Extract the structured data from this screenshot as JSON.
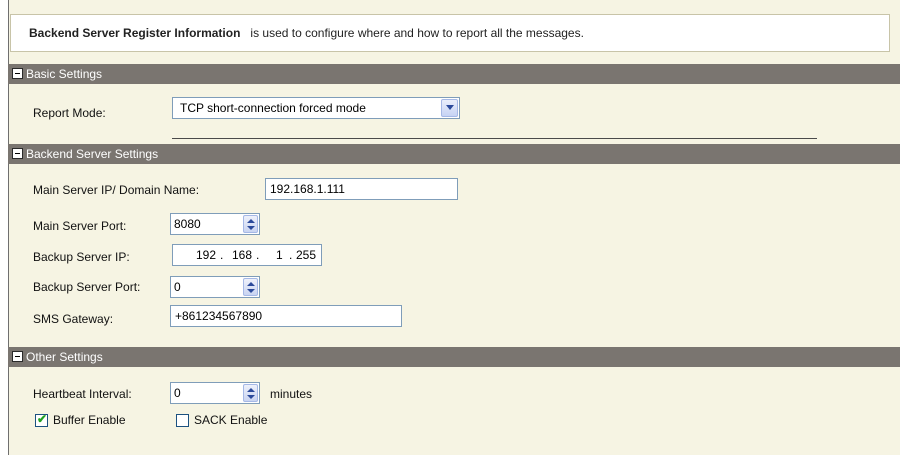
{
  "info": {
    "title_bold": "Backend Server Register Information",
    "description": "is used to configure where and how to report all the messages."
  },
  "basic": {
    "header": "Basic Settings",
    "report_mode_label": "Report Mode:",
    "report_mode_value": "TCP short-connection forced mode"
  },
  "backend": {
    "header": "Backend Server Settings",
    "main_ip_label": "Main Server IP/ Domain Name:",
    "main_ip_value": "192.168.1.111",
    "main_port_label": "Main Server Port:",
    "main_port_value": "8080",
    "backup_ip_label": "Backup Server IP:",
    "backup_ip": [
      "192",
      "168",
      "1",
      "255"
    ],
    "backup_ip_dot": ".",
    "backup_port_label": "Backup Server Port:",
    "backup_port_value": "0",
    "sms_label": "SMS Gateway:",
    "sms_value": "+861234567890"
  },
  "other": {
    "header": "Other Settings",
    "heartbeat_label": "Heartbeat Interval:",
    "heartbeat_value": "0",
    "heartbeat_unit": "minutes",
    "buffer_label": "Buffer Enable",
    "buffer_checked": true,
    "buffer_mark": "✔",
    "sack_label": "SACK Enable",
    "sack_checked": false
  }
}
